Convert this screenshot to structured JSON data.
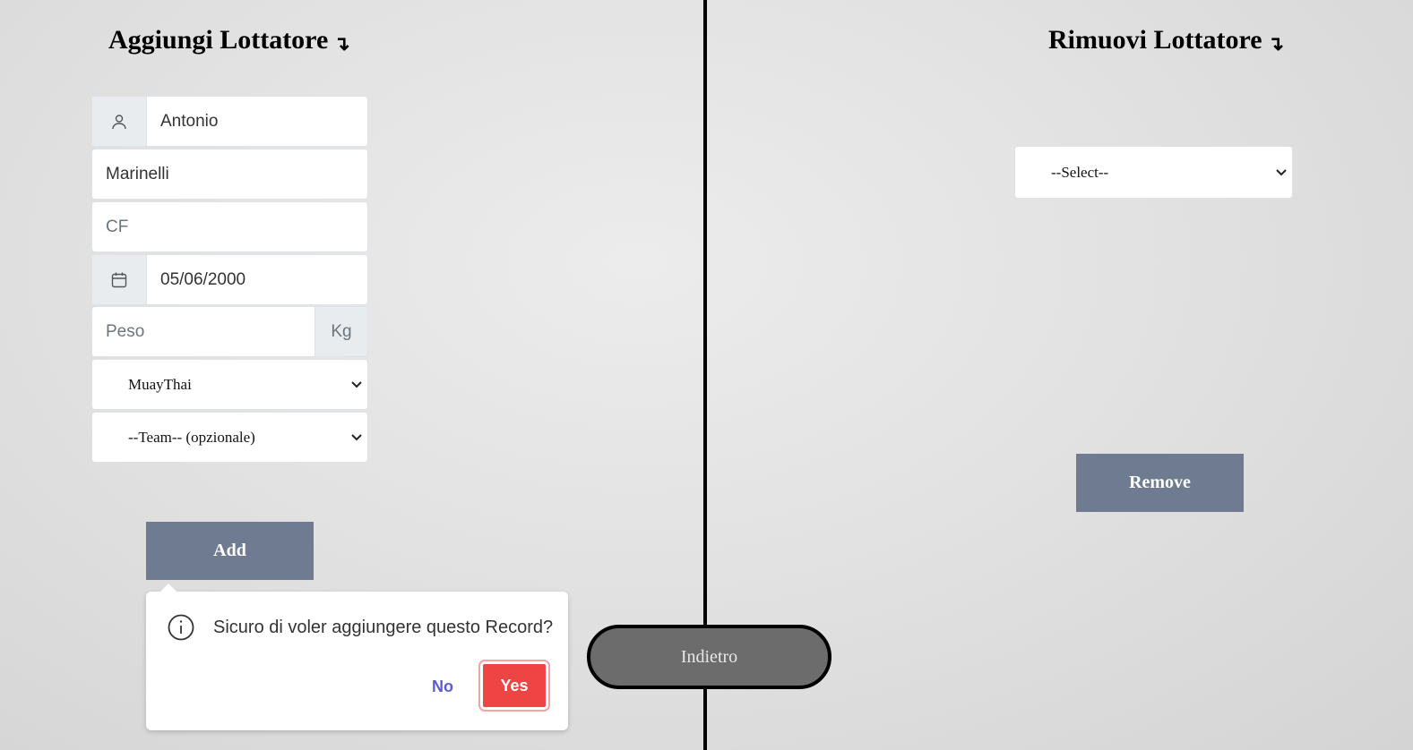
{
  "left_panel": {
    "title": "Aggiungi Lottatore",
    "title_arrow": "↴",
    "first_name": {
      "value": "Antonio",
      "icon": "user-icon"
    },
    "last_name": {
      "value": "Marinelli"
    },
    "cf": {
      "placeholder": "CF"
    },
    "birth_date": {
      "value": "05/06/2000",
      "icon": "calendar-icon"
    },
    "weight": {
      "placeholder": "Peso",
      "unit": "Kg"
    },
    "discipline_select": {
      "selected": "MuayThai"
    },
    "team_select": {
      "selected": "--Team-- (opzionale)"
    },
    "add_label": "Add"
  },
  "right_panel": {
    "title": "Rimuovi Lottatore",
    "title_arrow": "↴",
    "select": {
      "selected": "--Select--"
    },
    "remove_label": "Remove"
  },
  "back_label": "Indietro",
  "confirm_popover": {
    "icon": "info-icon",
    "message": "Sicuro di voler aggiungere questo Record?",
    "no_label": "No",
    "yes_label": "Yes"
  },
  "colors": {
    "button_slate": "#6e7b91",
    "yes_red": "#ef4444",
    "no_link": "#5b5bd6",
    "back_button": "#6c6c6c"
  }
}
